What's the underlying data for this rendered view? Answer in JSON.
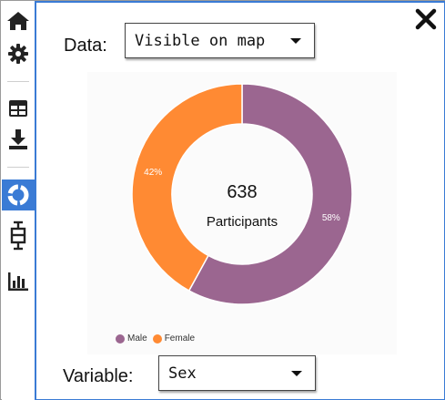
{
  "panel": {
    "data_label": "Data:",
    "data_select_value": "Visible on map",
    "variable_label": "Variable:",
    "variable_select_value": "Sex"
  },
  "toolbar": {
    "items": [
      {
        "icon": "home-icon"
      },
      {
        "icon": "gear-icon"
      },
      {
        "icon": "table-icon"
      },
      {
        "icon": "download-icon"
      },
      {
        "icon": "donut-chart-icon",
        "active": true
      },
      {
        "icon": "boxplot-icon"
      },
      {
        "icon": "bar-chart-icon"
      }
    ]
  },
  "colors": {
    "accent": "#3a7bd5",
    "male": "#9b6690",
    "female": "#ff8a33"
  },
  "chart_data": {
    "type": "pie",
    "title": "",
    "center_value": "638",
    "center_label": "Participants",
    "slices": [
      {
        "name": "Male",
        "value": 58,
        "label": "58%"
      },
      {
        "name": "Female",
        "value": 42,
        "label": "42%"
      }
    ],
    "legend": [
      "Male",
      "Female"
    ],
    "legend_position": "bottom-left"
  }
}
